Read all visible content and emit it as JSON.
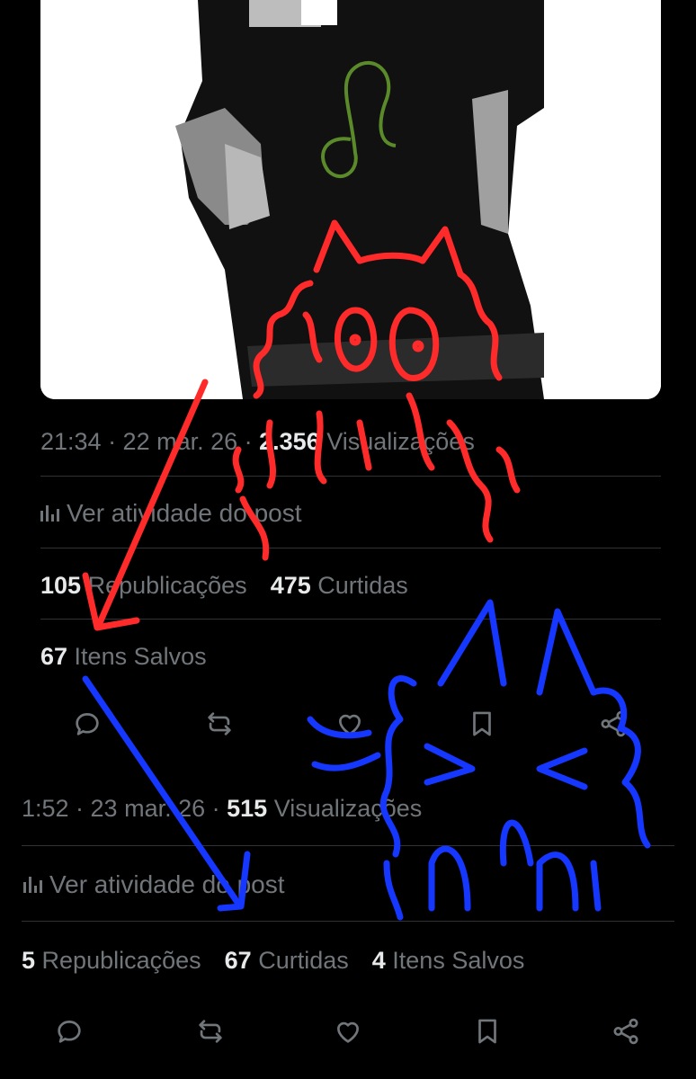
{
  "post1": {
    "timestamp": "21:34 · 22 mar. 26 · ",
    "views_count": "2.356",
    "views_label": " Visualizações",
    "activity_label": "Ver atividade do post",
    "reposts_count": "105",
    "reposts_label": " Republicações",
    "likes_count": "475",
    "likes_label": " Curtidas",
    "saves_count": "67",
    "saves_label": " Itens Salvos"
  },
  "post2": {
    "timestamp": "1:52 · 23 mar. 26 · ",
    "views_count": "515",
    "views_label": " Visualizações",
    "activity_label": "Ver atividade do post",
    "reposts_count": "5",
    "reposts_label": " Republicações",
    "likes_count": "67",
    "likes_label": " Curtidas",
    "saves_count": "4",
    "saves_label": " Itens Salvos"
  },
  "icons": [
    "reply-icon",
    "repost-icon",
    "like-icon",
    "bookmark-icon",
    "share-icon"
  ],
  "colors": {
    "background": "#000000",
    "primary_text": "#e7e9ea",
    "secondary_text": "#71767b",
    "divider": "#2f3336",
    "red_drawing": "#ff2a2a",
    "blue_drawing": "#1537ff"
  }
}
